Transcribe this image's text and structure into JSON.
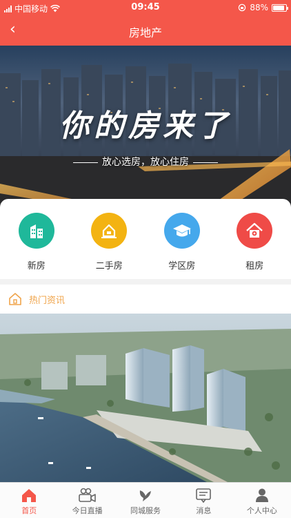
{
  "status_bar": {
    "carrier": "中国移动",
    "time": "09:45",
    "battery": "88%",
    "battery_level": 0.88
  },
  "nav": {
    "title": "房地产",
    "back_icon": "chevron-left-icon"
  },
  "banner": {
    "headline": "你的房来了",
    "slogan": "放心选房，放心住房"
  },
  "categories": [
    {
      "label": "新房",
      "icon": "building-icon",
      "color": "#1fb89a"
    },
    {
      "label": "二手房",
      "icon": "house-hand-icon",
      "color": "#f3b312"
    },
    {
      "label": "学区房",
      "icon": "graduation-cap-icon",
      "color": "#45a8ec"
    },
    {
      "label": "租房",
      "icon": "house-key-icon",
      "color": "#ef4b47"
    }
  ],
  "news": {
    "title": "热门资讯",
    "icon": "house-outline-icon"
  },
  "tabbar": {
    "active_color": "#f4574a",
    "items": [
      {
        "label": "首页",
        "icon": "home-icon"
      },
      {
        "label": "今日直播",
        "icon": "video-camera-icon"
      },
      {
        "label": "同城服务",
        "icon": "dove-icon"
      },
      {
        "label": "消息",
        "icon": "message-icon"
      },
      {
        "label": "个人中心",
        "icon": "user-icon"
      }
    ]
  }
}
